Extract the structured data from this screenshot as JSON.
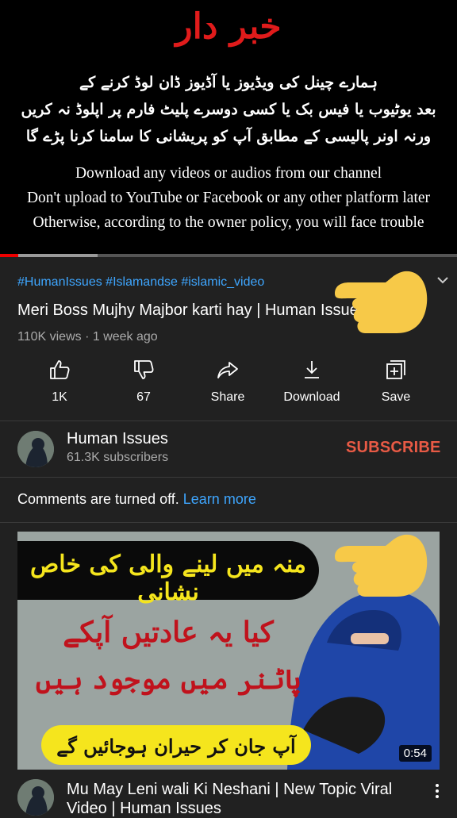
{
  "player": {
    "warning_title": "خبر دار",
    "urdu_lines": [
      "ہمارے چینل کی ویڈیوز یا آڈیوز ڈان لوڈ کرنے کے",
      "بعد یوٹیوب یا فیس بک یا کسی دوسرے پلیٹ فارم پر اپلوڈ نہ کریں",
      "ورنہ اونر پالیسی کے مطابق آپ کو پریشانی کا سامنا کرنا پڑے گا"
    ],
    "english_lines": [
      "Download any videos or audios from our channel",
      "Don't upload to YouTube or Facebook or any other platform later",
      "Otherwise, according to the owner policy, you will face trouble"
    ],
    "progress_fraction": 0.04
  },
  "video": {
    "hashtags": "#HumanIssues #Islamandse #islamic_video",
    "title": "Meri Boss Mujhy Majbor karti hay |  Human Issues",
    "meta": "110K views · 1 week ago"
  },
  "actions": {
    "like": "1K",
    "dislike": "67",
    "share": "Share",
    "download": "Download",
    "save": "Save"
  },
  "channel": {
    "name": "Human Issues",
    "subscribers": "61.3K subscribers",
    "subscribe_label": "SUBSCRIBE"
  },
  "comments": {
    "text": "Comments are turned off. ",
    "link": "Learn more"
  },
  "next_video": {
    "thumb_line1": "منہ میں لینے والی کی خاص نشانی",
    "thumb_line2": "کیا یہ عادتیں آپکے",
    "thumb_line3": "پاٹنر میں موجود ہیں",
    "thumb_line4": "آپ جان کر حیران ہوجائیں گے",
    "duration": "0:54",
    "title": "Mu May Leni wali Ki Neshani | New Topic Viral Video | Human Issues"
  },
  "colors": {
    "accent_link": "#3ea6ff",
    "subscribe": "#e85a45",
    "warning_red": "#e01b1b"
  }
}
